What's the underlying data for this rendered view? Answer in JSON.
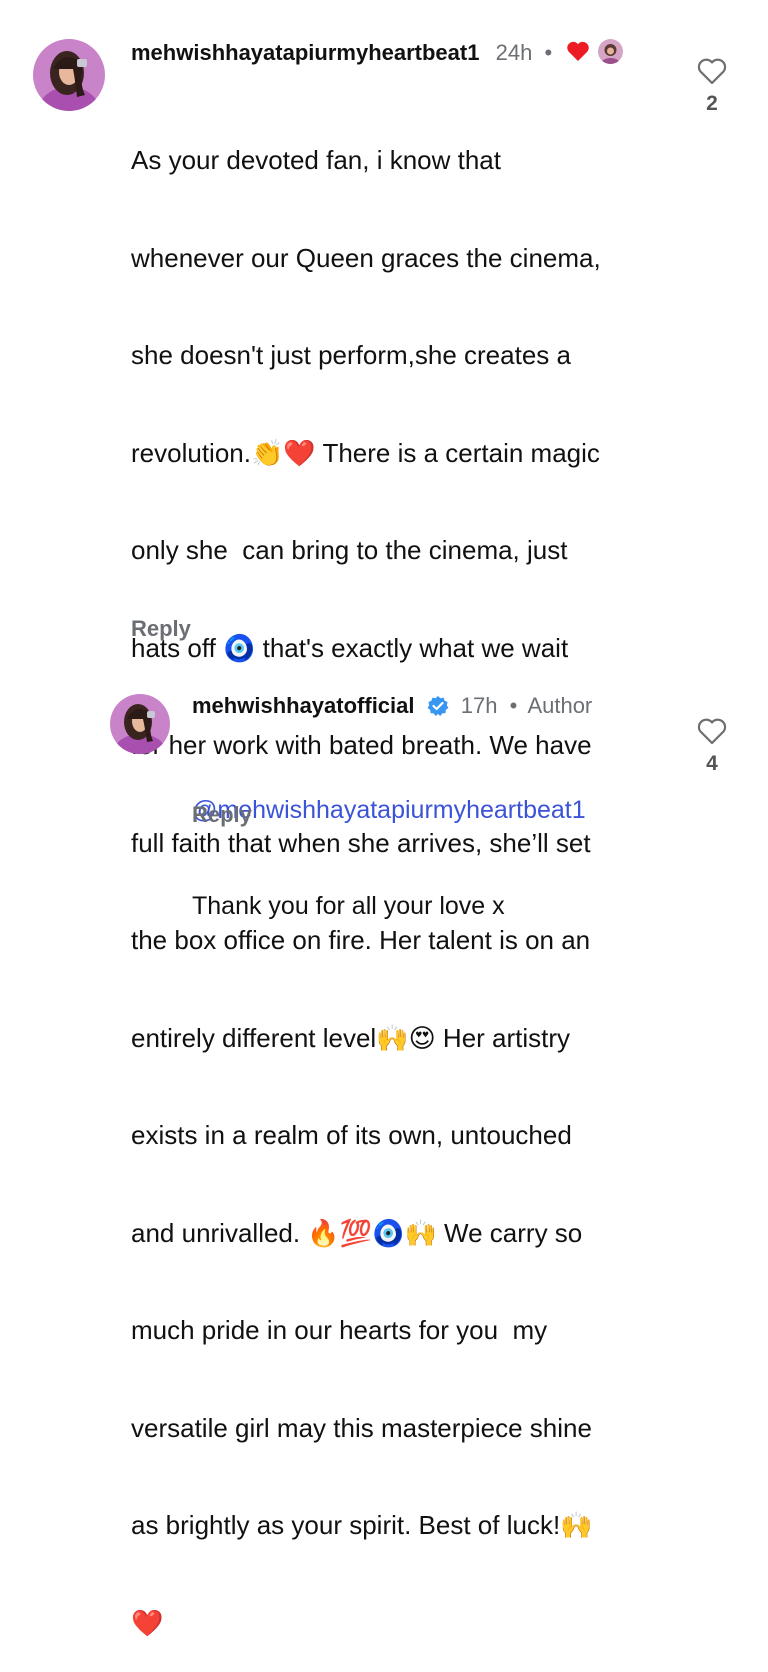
{
  "comment": {
    "username": "mehwishhayatapiurmyheartbeat1",
    "time": "24h",
    "separator": "•",
    "body_lines": [
      "As your devoted fan, i know that",
      "whenever our Queen graces the cinema,",
      "she doesn't just perform,she creates a",
      "revolution.👏❤️ There is a certain magic",
      "only she  can bring to the cinema, just",
      "hats off 🧿 that's exactly what we wait",
      "for her work with bated breath. We have",
      "full faith that when she arrives, she’ll set",
      "the box office on fire. Her talent is on an",
      "entirely different level🙌😍 Her artistry",
      "exists in a realm of its own, untouched",
      "and unrivalled. 🔥💯🧿🙌 We carry so",
      "much pride in our hearts for you  my",
      "versatile girl may this masterpiece shine",
      "as brightly as your spirit. Best of luck!🙌",
      "❤️"
    ],
    "reply_label": "Reply",
    "like_count": "2"
  },
  "reply": {
    "username": "mehwishhayatofficial",
    "time": "17h",
    "separator": "•",
    "author_badge": "Author",
    "mention": "@mehwishhayatapiurmyheartbeat1",
    "text": "Thank you for all your love x",
    "reply_label": "Reply",
    "like_count": "4"
  },
  "colors": {
    "accent_mention": "#3b53d6",
    "verified_badge": "#3897f0",
    "liked_heart": "#ed1c24",
    "muted": "#6b6f74"
  }
}
